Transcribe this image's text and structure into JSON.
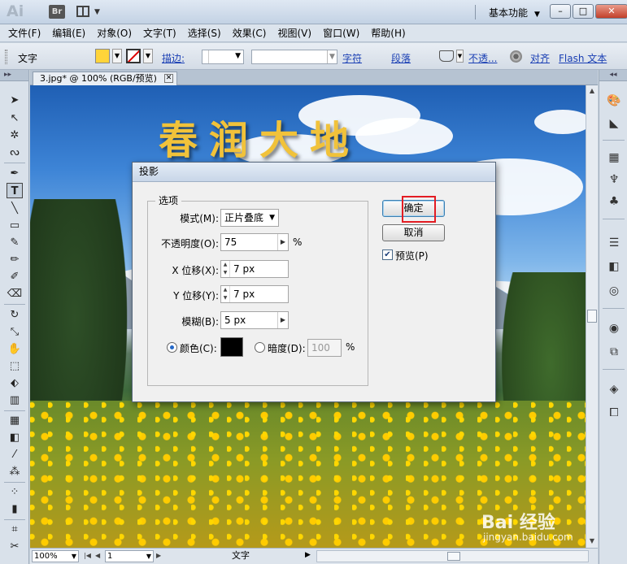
{
  "titlebar": {
    "app_logo": "Ai",
    "bridge_label": "Br",
    "workspace": "基本功能"
  },
  "menu": [
    "文件(F)",
    "编辑(E)",
    "对象(O)",
    "文字(T)",
    "选择(S)",
    "效果(C)",
    "视图(V)",
    "窗口(W)",
    "帮助(H)"
  ],
  "controlbar": {
    "mode_label": "文字",
    "stroke_label": "描边:",
    "fill_color": "#ffd43a",
    "links": [
      "字符",
      "段落",
      "不透...",
      "对齐",
      "Flash 文本"
    ]
  },
  "document": {
    "tab_title": "3.jpg* @ 100% (RGB/预览)",
    "poster_title": "春润大地",
    "watermark": "Bai 经验",
    "watermark_sub": "jingyan.baidu.com"
  },
  "statusbar": {
    "zoom": "100%",
    "page": "1",
    "status_text": "文字"
  },
  "dialog": {
    "title": "投影",
    "options_group": "选项",
    "mode_label": "模式(M):",
    "mode_value": "正片叠底",
    "opacity_label": "不透明度(O):",
    "opacity_value": "75",
    "opacity_unit": "%",
    "xoffset_label": "X 位移(X):",
    "xoffset_value": "7 px",
    "yoffset_label": "Y 位移(Y):",
    "yoffset_value": "7 px",
    "blur_label": "模糊(B):",
    "blur_value": "5 px",
    "color_label": "颜色(C):",
    "color_value": "#000000",
    "darkness_label": "暗度(D):",
    "darkness_value": "100",
    "darkness_unit": "%",
    "ok_label": "确定",
    "cancel_label": "取消",
    "preview_label": "预览(P)",
    "preview_checked": true
  }
}
